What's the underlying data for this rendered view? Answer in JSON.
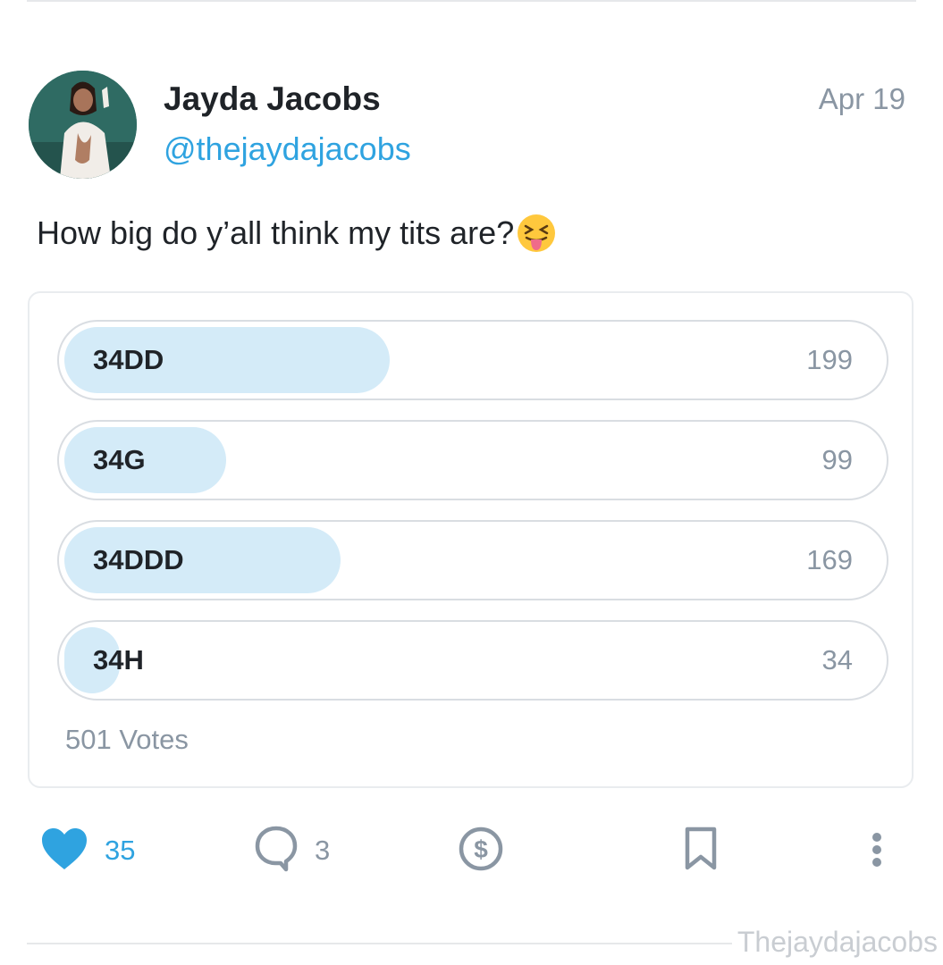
{
  "post": {
    "author_name": "Jayda Jacobs",
    "author_handle": "@thejaydajacobs",
    "date": "Apr 19",
    "text": "How big do y’all think my tits are?",
    "emoji": "squinting-face-with-tongue-emoji"
  },
  "poll": {
    "options": [
      {
        "label": "34DD",
        "count": "199",
        "votes": 199
      },
      {
        "label": "34G",
        "count": "99",
        "votes": 99
      },
      {
        "label": "34DDD",
        "count": "169",
        "votes": 169
      },
      {
        "label": "34H",
        "count": "34",
        "votes": 34
      }
    ],
    "total_votes": "501 Votes",
    "max_votes": 199
  },
  "actions": {
    "likes": "35",
    "comments": "3",
    "like_icon": "heart-icon",
    "comment_icon": "comment-bubble-icon",
    "tip_icon": "dollar-coin-icon",
    "bookmark_icon": "bookmark-icon",
    "more_icon": "more-vertical-icon"
  },
  "watermark": "Thejaydajacobs",
  "colors": {
    "accent": "#2fa3e0",
    "muted": "#8a96a3",
    "poll_fill": "#d4ebf8"
  }
}
